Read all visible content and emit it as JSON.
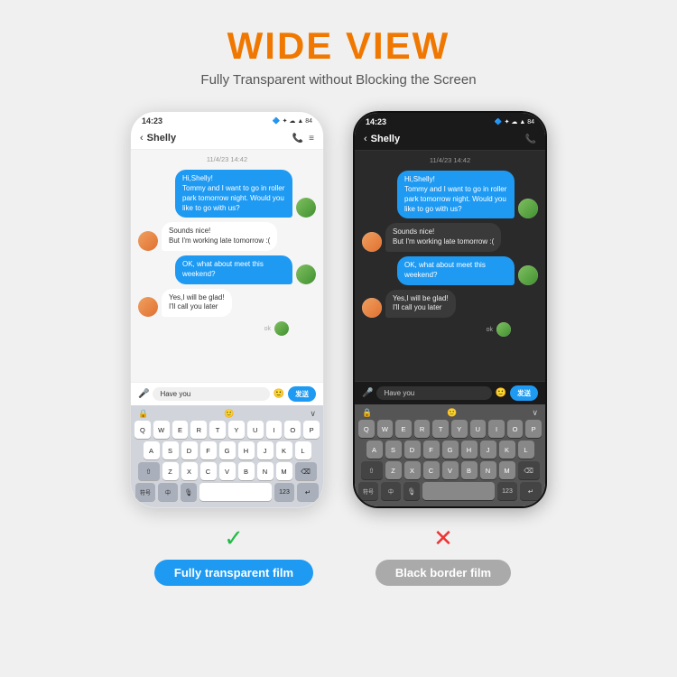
{
  "header": {
    "title": "WIDE VIEW",
    "subtitle": "Fully Transparent without Blocking the Screen"
  },
  "phone_left": {
    "status_time": "14:23",
    "status_icons": "🔵 ✦ ☁ 令 84",
    "contact": "Shelly",
    "date_label": "11/4/23 14:42",
    "messages": [
      {
        "type": "sent",
        "text": "Hi,Shelly!\nTommy and I want to go in roller park tomorrow night. Would you like to go with us?"
      },
      {
        "type": "received",
        "text": "Sounds nice!\nBut I'm working late tomorrow :("
      },
      {
        "type": "sent",
        "text": "OK, what about meet this weekend?"
      },
      {
        "type": "received",
        "text": "Yes,I will be glad!\nI'll call you later"
      }
    ],
    "input_text": "Have you",
    "send_label": "发送"
  },
  "phone_right": {
    "status_time": "14:23",
    "status_icons": "🔵 ✦ ☁ 令 84",
    "contact": "Shelly",
    "date_label": "11/4/23 14:42",
    "messages": [
      {
        "type": "sent",
        "text": "Hi,Shelly!\nTommy and I want to go in roller park tomorrow night. Would you like to go with us?"
      },
      {
        "type": "received",
        "text": "Sounds nice!\nBut I'm working late tomorrow :("
      },
      {
        "type": "sent",
        "text": "OK, what about meet this weekend?"
      },
      {
        "type": "received",
        "text": "Yes,I will be glad!\nI'll call you later"
      }
    ],
    "input_text": "Have you",
    "send_label": "发送"
  },
  "labels": {
    "left": {
      "check": "✓",
      "text": "Fully transparent film"
    },
    "right": {
      "cross": "✕",
      "text": "Black border film"
    }
  },
  "keyboard": {
    "rows": [
      [
        "Q",
        "W",
        "E",
        "R",
        "T",
        "Y",
        "U",
        "I",
        "O",
        "P"
      ],
      [
        "A",
        "S",
        "D",
        "F",
        "G",
        "H",
        "J",
        "K",
        "L"
      ],
      [
        "⇧",
        "Z",
        "X",
        "C",
        "V",
        "B",
        "N",
        "M",
        "⌫"
      ]
    ],
    "bottom": [
      "符号",
      "中",
      "⬆",
      "",
      "123",
      "↵"
    ]
  }
}
